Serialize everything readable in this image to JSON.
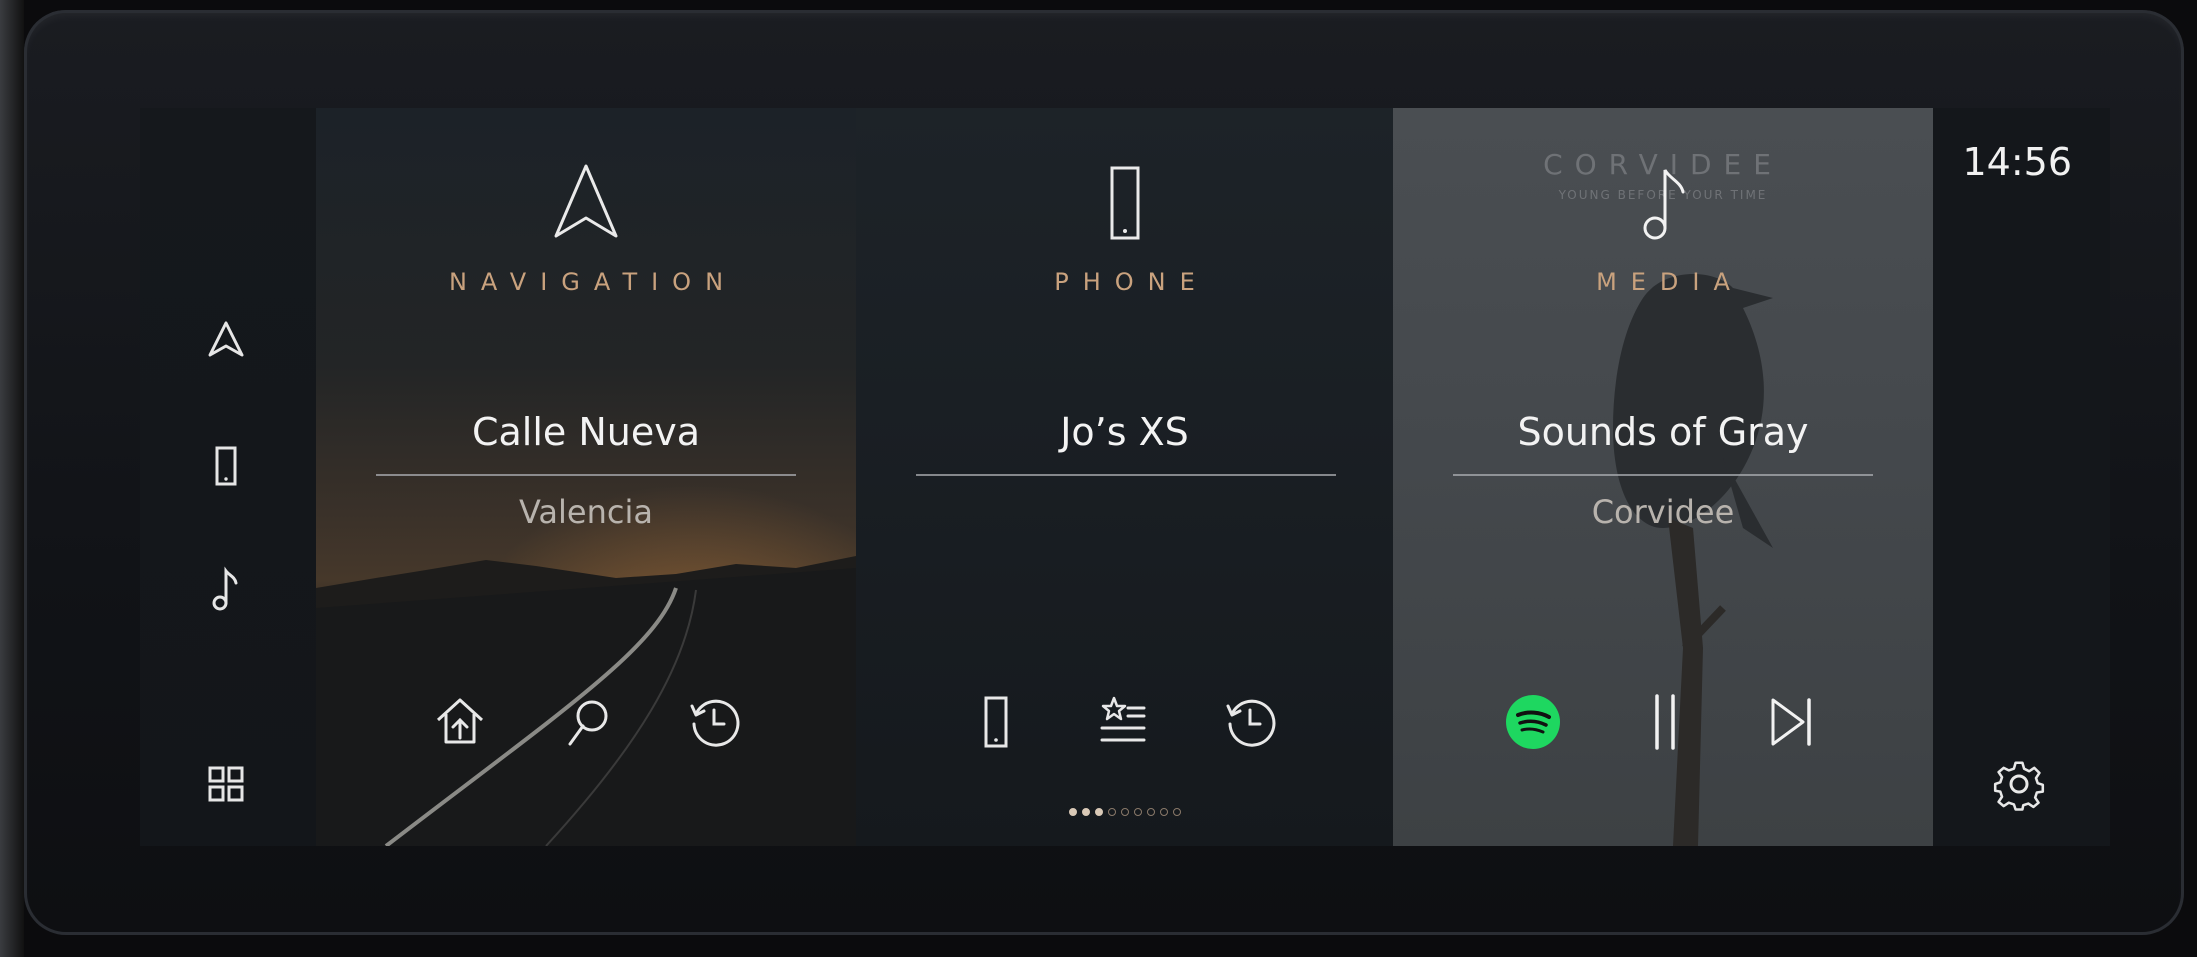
{
  "status": {
    "time": "14:56"
  },
  "rail": {
    "items": [
      {
        "icon": "navigation-arrow-icon"
      },
      {
        "icon": "phone-icon"
      },
      {
        "icon": "music-note-icon"
      },
      {
        "icon": "apps-grid-icon"
      }
    ]
  },
  "navigation": {
    "title": "NAVIGATION",
    "primary": "Calle Nueva",
    "secondary": "Valencia",
    "actions": [
      "home-icon",
      "search-icon",
      "recent-icon"
    ]
  },
  "phone": {
    "title": "PHONE",
    "primary": "Jo’s XS",
    "actions": [
      "phone-icon",
      "favourites-icon",
      "recent-icon"
    ],
    "pagination": {
      "total": 9,
      "active": 3
    }
  },
  "media": {
    "title": "MEDIA",
    "primary": "Sounds of Gray",
    "secondary": "Corvidee",
    "album_art": {
      "brand": "CORVIDEE",
      "tagline": "YOUNG BEFORE YOUR TIME"
    },
    "actions": [
      "spotify-icon",
      "pause-icon",
      "skip-next-icon"
    ],
    "colors": {
      "spotify": "#1ed760"
    }
  },
  "theme": {
    "accent": "#c9a27e",
    "text": "#f3f3f3"
  }
}
